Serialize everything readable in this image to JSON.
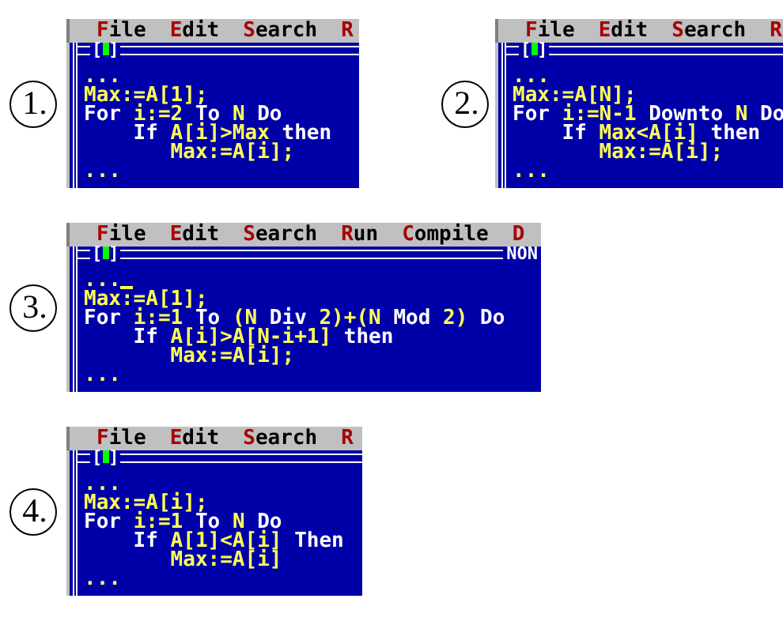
{
  "figures": [
    {
      "label": "1.",
      "menu": [
        {
          "key": "F",
          "rest": "ile"
        },
        {
          "key": "E",
          "rest": "dit"
        },
        {
          "key": "S",
          "rest": "earch"
        },
        {
          "key": "R"
        }
      ],
      "close_box": {
        "left": "[",
        "right": "]"
      },
      "cursor": false,
      "code": [
        [
          {
            "t": "...",
            "kind": "id"
          }
        ],
        [
          {
            "t": "Max:=A[1];",
            "kind": "id"
          }
        ],
        [
          {
            "t": "For ",
            "kind": "kw"
          },
          {
            "t": "i:=2",
            "kind": "id"
          },
          {
            "t": " To ",
            "kind": "kw"
          },
          {
            "t": "N",
            "kind": "id"
          },
          {
            "t": " Do",
            "kind": "kw"
          }
        ],
        [
          {
            "t": "    If ",
            "kind": "kw"
          },
          {
            "t": "A[i]>Max",
            "kind": "id"
          },
          {
            "t": " then",
            "kind": "kw"
          }
        ],
        [
          {
            "t": "       Max:=A[i];",
            "kind": "id"
          }
        ],
        [
          {
            "t": "...",
            "kind": "id"
          }
        ]
      ]
    },
    {
      "label": "2.",
      "menu": [
        {
          "key": "F",
          "rest": "ile"
        },
        {
          "key": "E",
          "rest": "dit"
        },
        {
          "key": "S",
          "rest": "earch"
        },
        {
          "key": "R"
        }
      ],
      "close_box": {
        "left": "[",
        "right": "]"
      },
      "cursor": false,
      "code": [
        [
          {
            "t": "...",
            "kind": "id"
          }
        ],
        [
          {
            "t": "Max:=A[N];",
            "kind": "id"
          }
        ],
        [
          {
            "t": "For ",
            "kind": "kw"
          },
          {
            "t": "i:=N-1",
            "kind": "id"
          },
          {
            "t": " Downto ",
            "kind": "kw"
          },
          {
            "t": "N",
            "kind": "id"
          },
          {
            "t": " Do",
            "kind": "kw"
          }
        ],
        [
          {
            "t": "    If ",
            "kind": "kw"
          },
          {
            "t": "Max<A[i]",
            "kind": "id"
          },
          {
            "t": " then",
            "kind": "kw"
          }
        ],
        [
          {
            "t": "       Max:=A[i];",
            "kind": "id"
          }
        ],
        [
          {
            "t": "...",
            "kind": "id"
          }
        ]
      ]
    },
    {
      "label": "3.",
      "menu": [
        {
          "key": "F",
          "rest": "ile"
        },
        {
          "key": "E",
          "rest": "dit"
        },
        {
          "key": "S",
          "rest": "earch"
        },
        {
          "key": "R",
          "rest": "un"
        },
        {
          "key": "C",
          "rest": "ompile"
        },
        {
          "key": "D"
        }
      ],
      "close_box": {
        "left": "[",
        "right": "]"
      },
      "status": "NON",
      "cursor": true,
      "code": [
        [
          {
            "t": "...",
            "kind": "id"
          }
        ],
        [
          {
            "t": "Max:=A[1];",
            "kind": "id"
          }
        ],
        [
          {
            "t": "For ",
            "kind": "kw"
          },
          {
            "t": "i:=1",
            "kind": "id"
          },
          {
            "t": " To ",
            "kind": "kw"
          },
          {
            "t": "(N",
            "kind": "id"
          },
          {
            "t": " Div ",
            "kind": "kw"
          },
          {
            "t": "2)+(N",
            "kind": "id"
          },
          {
            "t": " Mod ",
            "kind": "kw"
          },
          {
            "t": "2)",
            "kind": "id"
          },
          {
            "t": " Do",
            "kind": "kw"
          }
        ],
        [
          {
            "t": "    If ",
            "kind": "kw"
          },
          {
            "t": "A[i]>A[N-i+1]",
            "kind": "id"
          },
          {
            "t": " then",
            "kind": "kw"
          }
        ],
        [
          {
            "t": "       Max:=A[i];",
            "kind": "id"
          }
        ],
        [
          {
            "t": "...",
            "kind": "id"
          }
        ]
      ]
    },
    {
      "label": "4.",
      "menu": [
        {
          "key": "F",
          "rest": "ile"
        },
        {
          "key": "E",
          "rest": "dit"
        },
        {
          "key": "S",
          "rest": "earch"
        },
        {
          "key": "R"
        }
      ],
      "close_box": {
        "left": "[",
        "right": "]"
      },
      "cursor": false,
      "code": [
        [
          {
            "t": "...",
            "kind": "id"
          }
        ],
        [
          {
            "t": "Max:=A[i];",
            "kind": "id"
          }
        ],
        [
          {
            "t": "For ",
            "kind": "kw"
          },
          {
            "t": "i:=1",
            "kind": "id"
          },
          {
            "t": " To ",
            "kind": "kw"
          },
          {
            "t": "N",
            "kind": "id"
          },
          {
            "t": " Do",
            "kind": "kw"
          }
        ],
        [
          {
            "t": "    If ",
            "kind": "kw"
          },
          {
            "t": "A[1]<A[i]",
            "kind": "id"
          },
          {
            "t": " Then",
            "kind": "kw"
          }
        ],
        [
          {
            "t": "       Max:=A[i]",
            "kind": "id"
          }
        ],
        [
          {
            "t": "...",
            "kind": "id"
          }
        ]
      ]
    }
  ]
}
